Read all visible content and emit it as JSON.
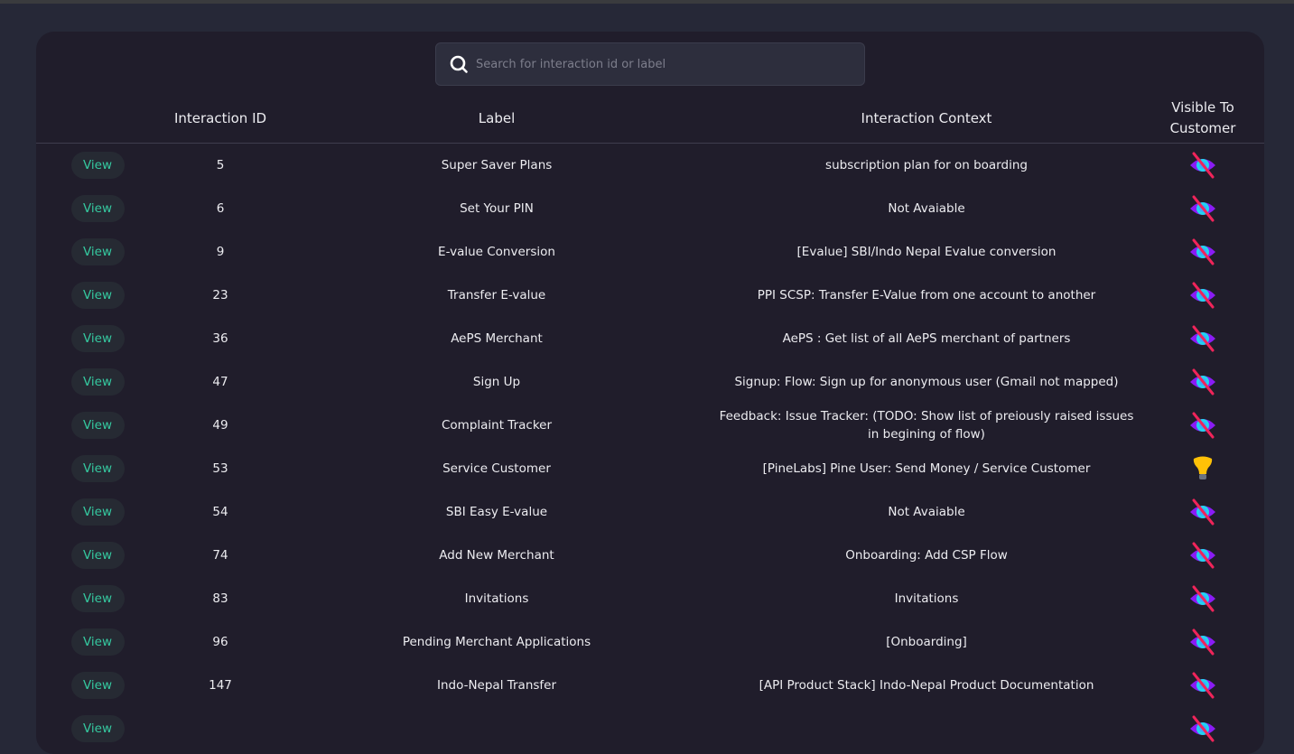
{
  "search": {
    "placeholder": "Search for interaction id or label",
    "value": "",
    "icon": "search-icon"
  },
  "table": {
    "headers": {
      "id": "Interaction ID",
      "label": "Label",
      "context": "Interaction Context",
      "visible": "Visible To Customer"
    },
    "view_label": "View",
    "rows": [
      {
        "id": "5",
        "label": "Super Saver Plans",
        "context": "subscription plan for on boarding",
        "visible": false
      },
      {
        "id": "6",
        "label": "Set Your PIN",
        "context": "Not Avaiable",
        "visible": false
      },
      {
        "id": "9",
        "label": "E-value Conversion",
        "context": "[Evalue] SBI/Indo Nepal Evalue conversion",
        "visible": false
      },
      {
        "id": "23",
        "label": "Transfer E-value",
        "context": "PPI SCSP: Transfer E-Value from one account to another",
        "visible": false
      },
      {
        "id": "36",
        "label": "AePS Merchant",
        "context": "AePS : Get list of all AePS merchant of partners",
        "visible": false
      },
      {
        "id": "47",
        "label": "Sign Up",
        "context": "Signup: Flow: Sign up for anonymous user (Gmail not mapped)",
        "visible": false
      },
      {
        "id": "49",
        "label": "Complaint Tracker",
        "context": "Feedback: Issue Tracker: (TODO: Show list of preiously raised issues in begining of flow)",
        "visible": false
      },
      {
        "id": "53",
        "label": "Service Customer",
        "context": "[PineLabs] Pine User: Send Money / Service Customer",
        "visible": true
      },
      {
        "id": "54",
        "label": "SBI Easy E-value",
        "context": "Not Avaiable",
        "visible": false
      },
      {
        "id": "74",
        "label": "Add New Merchant",
        "context": "Onboarding: Add CSP Flow",
        "visible": false
      },
      {
        "id": "83",
        "label": "Invitations",
        "context": "Invitations",
        "visible": false
      },
      {
        "id": "96",
        "label": "Pending Merchant Applications",
        "context": "[Onboarding]",
        "visible": false
      },
      {
        "id": "147",
        "label": "Indo-Nepal Transfer",
        "context": "[API Product Stack] Indo-Nepal Product Documentation",
        "visible": false
      },
      {
        "id": "",
        "label": "",
        "context": "",
        "visible": false
      }
    ]
  },
  "icons": {
    "visible_true": "lightbulb-icon",
    "visible_false": "eye-off-icon"
  },
  "colors": {
    "accent_view": "#35c9a0",
    "panel_bg": "#201d2b",
    "page_bg": "#262837",
    "eye_purple": "#8a1cf5",
    "eye_cyan": "#22d3ee",
    "strike_red": "#f0245a",
    "bulb_yellow": "#ffc107"
  }
}
